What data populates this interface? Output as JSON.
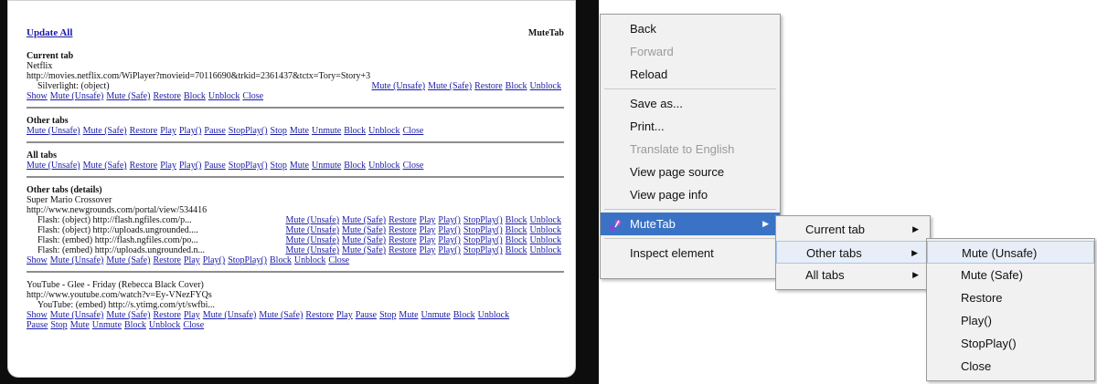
{
  "popup": {
    "update_all": "Update All",
    "brand": "MuteTab",
    "current_tab": {
      "heading": "Current tab",
      "site": "Netflix",
      "url": "http://movies.netflix.com/WiPlayer?movieid=70116690&trkid=2361437&tctx=Tory=Story+3",
      "plugin": "Silverlight: (object)",
      "plugin_links": [
        "Mute (Unsafe)",
        "Mute (Safe)",
        "Restore",
        "Block",
        "Unblock"
      ],
      "links": [
        "Show",
        "Mute (Unsafe)",
        "Mute (Safe)",
        "Restore",
        "Block",
        "Unblock",
        "Close"
      ]
    },
    "other_tabs": {
      "heading": "Other tabs",
      "links": [
        "Mute (Unsafe)",
        "Mute (Safe)",
        "Restore",
        "Play",
        "Play()",
        "Pause",
        "StopPlay()",
        "Stop",
        "Mute",
        "Unmute",
        "Block",
        "Unblock",
        "Close"
      ]
    },
    "all_tabs": {
      "heading": "All tabs",
      "links": [
        "Mute (Unsafe)",
        "Mute (Safe)",
        "Restore",
        "Play",
        "Play()",
        "Pause",
        "StopPlay()",
        "Stop",
        "Mute",
        "Unmute",
        "Block",
        "Unblock",
        "Close"
      ]
    },
    "other_details": {
      "heading": "Other tabs (details)",
      "site": "Super Mario Crossover",
      "url": "http://www.newgrounds.com/portal/view/534416",
      "flash_rows": [
        "Flash: (object) http://flash.ngfiles.com/p...",
        "Flash: (object) http://uploads.ungrounded....",
        "Flash: (embed) http://flash.ngfiles.com/po...",
        "Flash: (embed) http://uploads.ungrounded.n..."
      ],
      "flash_links": [
        "Mute (Unsafe)",
        "Mute (Safe)",
        "Restore",
        "Play",
        "Play()",
        "StopPlay()",
        "Block",
        "Unblock"
      ],
      "links": [
        "Show",
        "Mute (Unsafe)",
        "Mute (Safe)",
        "Restore",
        "Play",
        "Play()",
        "StopPlay()",
        "Block",
        "Unblock",
        "Close"
      ]
    },
    "youtube": {
      "site": "YouTube - Glee - Friday (Rebecca Black Cover)",
      "url": "http://www.youtube.com/watch?v=Ey-VNezFYQs",
      "plugin": "YouTube: (embed) http://s.ytimg.com/yt/swfbi...",
      "links1": [
        "Show",
        "Mute (Unsafe)",
        "Mute (Safe)",
        "Restore",
        "Play",
        "Mute (Unsafe)",
        "Mute (Safe)",
        "Restore",
        "Play",
        "Pause",
        "Stop",
        "Mute",
        "Unmute",
        "Block",
        "Unblock"
      ],
      "links2": [
        "Pause",
        "Stop",
        "Mute",
        "Unmute",
        "Block",
        "Unblock",
        "Close"
      ]
    }
  },
  "context_menu": {
    "items": [
      {
        "label": "Back",
        "disabled": false
      },
      {
        "label": "Forward",
        "disabled": true
      },
      {
        "label": "Reload",
        "disabled": false
      },
      {
        "label": "Save as...",
        "disabled": false
      },
      {
        "label": "Print...",
        "disabled": false
      },
      {
        "label": "Translate to English",
        "disabled": true
      },
      {
        "label": "View page source",
        "disabled": false
      },
      {
        "label": "View page info",
        "disabled": false
      },
      {
        "label": "MuteTab",
        "disabled": false
      },
      {
        "label": "Inspect element",
        "disabled": false
      }
    ],
    "submenu": [
      "Current tab",
      "Other tabs",
      "All tabs"
    ],
    "subsubmenu": [
      "Mute (Unsafe)",
      "Mute (Safe)",
      "Restore",
      "Play()",
      "StopPlay()",
      "Close"
    ],
    "highlight_color": "#3a73c6"
  }
}
